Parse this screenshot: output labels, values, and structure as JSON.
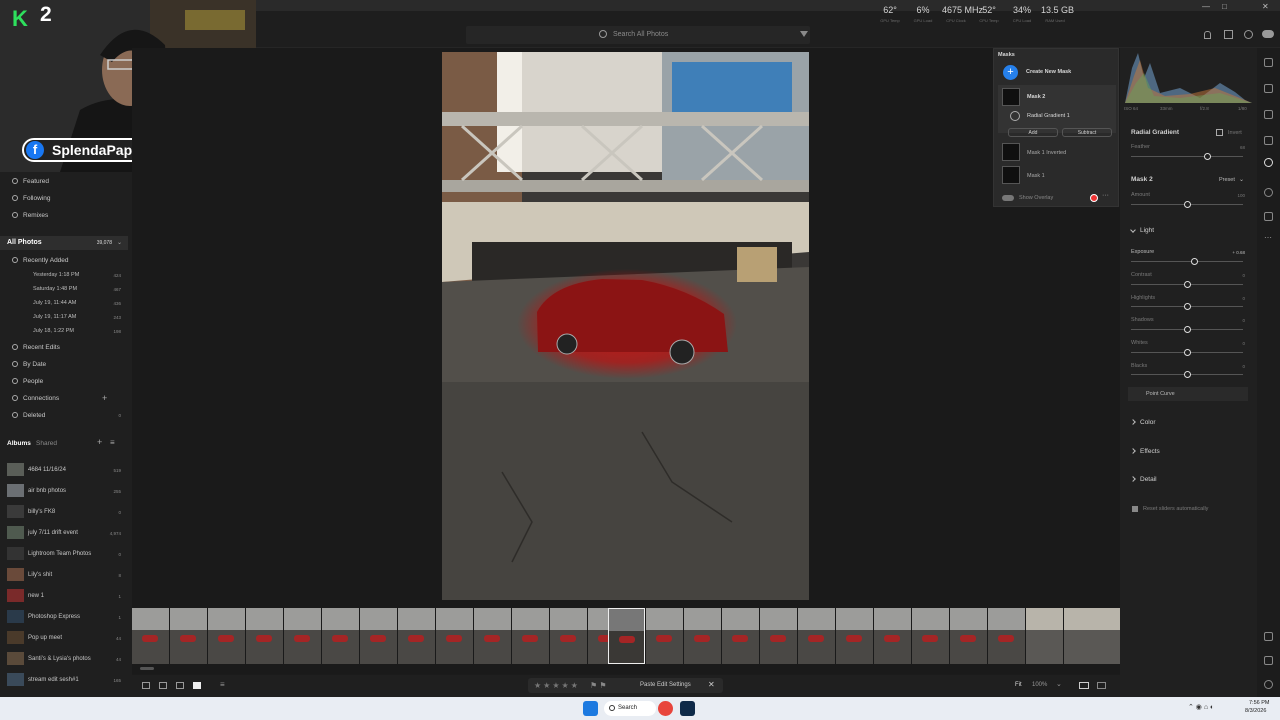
{
  "toolbar": {
    "search_placeholder": "Search All Photos"
  },
  "stats": [
    {
      "value": "62°",
      "label": "GPU Temp"
    },
    {
      "value": "6%",
      "label": "GPU Load"
    },
    {
      "value": "4675 MHz",
      "label": "CPU Clock"
    },
    {
      "value": "52°",
      "label": "CPU Temp"
    },
    {
      "value": "34%",
      "label": "CPU Load"
    },
    {
      "value": "13.5 GB",
      "label": "RAM Used"
    }
  ],
  "stream": {
    "k_logo": "K",
    "k_number": "2",
    "facebook_handle": "SplendaPapi"
  },
  "left_nav": {
    "featured": "Featured",
    "following": "Following",
    "remixes": "Remixes",
    "all_photos": "All Photos",
    "all_photos_count": "39,078",
    "recently_added": "Recently Added",
    "recent_items": [
      {
        "label": "Yesterday 1:18 PM",
        "count": "424"
      },
      {
        "label": "Saturday 1:48 PM",
        "count": "467"
      },
      {
        "label": "July 19, 11:44 AM",
        "count": "436"
      },
      {
        "label": "July 19, 11:17 AM",
        "count": "243"
      },
      {
        "label": "July 18, 1:22 PM",
        "count": "198"
      }
    ],
    "recent_edits": "Recent Edits",
    "by_date": "By Date",
    "people": "People",
    "connections": "Connections",
    "deleted": "Deleted",
    "deleted_count": "0",
    "albums_tab": "Albums",
    "shared_tab": "Shared"
  },
  "albums": [
    {
      "name": "4684 11/16/24",
      "count": "519"
    },
    {
      "name": "air bnb photos",
      "count": "255"
    },
    {
      "name": "billy's FK8",
      "count": "0"
    },
    {
      "name": "july 7/11 drift event",
      "count": "4,974"
    },
    {
      "name": "Lightroom Team Photos",
      "count": "0"
    },
    {
      "name": "Lily's shit",
      "count": "8"
    },
    {
      "name": "new 1",
      "count": "1"
    },
    {
      "name": "Photoshop Express",
      "count": "1"
    },
    {
      "name": "Pop up meet",
      "count": "44"
    },
    {
      "name": "Santi's & Lysia's photos",
      "count": "44"
    },
    {
      "name": "stream edit sesh#1",
      "count": "165"
    }
  ],
  "masks": {
    "title": "Masks",
    "create_new": "Create New Mask",
    "mask2": "Mask 2",
    "radial_gradient": "Radial Gradient 1",
    "add": "Add",
    "subtract": "Subtract",
    "mask1_inverted": "Mask 1 Inverted",
    "mask1": "Mask 1",
    "show_overlay": "Show Overlay"
  },
  "right_panel": {
    "histogram_labels": [
      "ISO 64",
      "33mm",
      "f/2.8",
      "1/80"
    ],
    "radial_gradient": "Radial Gradient",
    "invert": "Invert",
    "feather_label": "Feather",
    "feather_value": "68",
    "feather_fraction": 0.68,
    "mask2": "Mask 2",
    "preset": "Preset",
    "amount_label": "Amount",
    "amount_value": "100",
    "light": "Light",
    "sliders": [
      {
        "label": "Exposure",
        "value": "+ 0.68",
        "fraction": 0.57
      },
      {
        "label": "Contrast",
        "value": "0",
        "fraction": 0.5
      },
      {
        "label": "Highlights",
        "value": "0",
        "fraction": 0.5
      },
      {
        "label": "Shadows",
        "value": "0",
        "fraction": 0.5
      },
      {
        "label": "Whites",
        "value": "0",
        "fraction": 0.5
      },
      {
        "label": "Blacks",
        "value": "0",
        "fraction": 0.5
      }
    ],
    "point_curve": "Point Curve",
    "color": "Color",
    "effects": "Effects",
    "detail": "Detail",
    "reset_sliders": "Reset sliders automatically"
  },
  "bottom_bar": {
    "paste_edit": "Paste Edit Settings",
    "fit": "Fit",
    "zoom": "100%"
  },
  "taskbar": {
    "search": "Search",
    "time": "7:56 PM",
    "date": "8/3/2026"
  }
}
